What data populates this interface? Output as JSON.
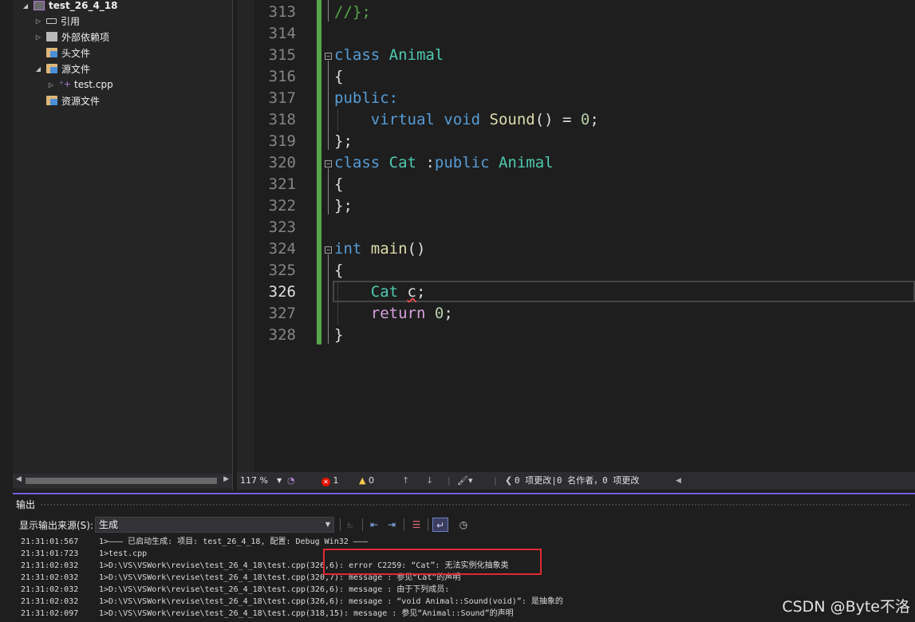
{
  "explorer": {
    "items": [
      {
        "label": "test_26_4_18"
      },
      {
        "label": "引用"
      },
      {
        "label": "外部依赖项"
      },
      {
        "label": "头文件"
      },
      {
        "label": "源文件"
      },
      {
        "label": "test.cpp"
      },
      {
        "label": "资源文件"
      }
    ]
  },
  "editor": {
    "line_numbers": [
      "313",
      "314",
      "315",
      "316",
      "317",
      "318",
      "319",
      "320",
      "321",
      "322",
      "323",
      "324",
      "325",
      "326",
      "327",
      "328"
    ],
    "active_line": "326",
    "lines": {
      "l313": "//};",
      "l315a": "class",
      "l315b": "Animal",
      "l316": "{",
      "l317": "public:",
      "l318a": "virtual",
      "l318b": "void",
      "l318c": "Sound",
      "l318d": "() = ",
      "l318e": "0",
      "l318f": ";",
      "l319": "};",
      "l320a": "class",
      "l320b": "Cat",
      "l320c": ":",
      "l320d": "public",
      "l320e": "Animal",
      "l321": "{",
      "l322": "};",
      "l324a": "int",
      "l324b": "main",
      "l324c": "()",
      "l325": "{",
      "l326a": "Cat",
      "l326b": "c",
      "l326c": ";",
      "l327a": "return",
      "l327b": "0",
      "l327c": ";",
      "l328": "}"
    }
  },
  "status": {
    "zoom": "117 %",
    "errors": "1",
    "warnings": "0",
    "changes": "0 项更改|0 名作者，0 项更改"
  },
  "output": {
    "title": "输出",
    "source_label": "显示输出来源(S):",
    "source_value": "生成",
    "lines": [
      {
        "time": "21:31:01:567",
        "text": "1>——— 已启动生成: 项目: test_26_4_18, 配置: Debug Win32 ———"
      },
      {
        "time": "21:31:01:723",
        "text": "1>test.cpp"
      },
      {
        "time": "21:31:02:032",
        "text": "1>D:\\VS\\VSWork\\revise\\test_26_4_18\\test.cpp(326,6): error C2259: “Cat”: 无法实例化抽象类"
      },
      {
        "time": "21:31:02:032",
        "text": "1>D:\\VS\\VSWork\\revise\\test_26_4_18\\test.cpp(320,7): message : 参见“Cat”的声明"
      },
      {
        "time": "21:31:02:032",
        "text": "1>D:\\VS\\VSWork\\revise\\test_26_4_18\\test.cpp(326,6): message : 由于下列成员:"
      },
      {
        "time": "21:31:02:032",
        "text": "1>D:\\VS\\VSWork\\revise\\test_26_4_18\\test.cpp(326,6): message : “void Animal::Sound(void)”: 是抽象的"
      },
      {
        "time": "21:31:02:097",
        "text": "1>D:\\VS\\VSWork\\revise\\test_26_4_18\\test.cpp(318,15): message : 参见“Animal::Sound”的声明"
      }
    ]
  },
  "watermark": "CSDN @Byte不洛",
  "colors": {
    "accent": "#7160e8",
    "change_bar": "#57a64a",
    "error_highlight": "#e0292f"
  }
}
